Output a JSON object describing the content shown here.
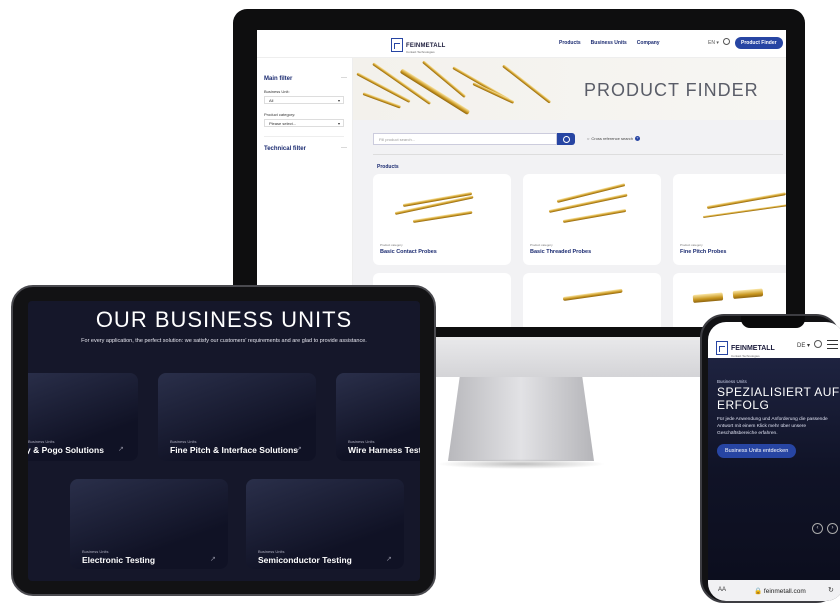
{
  "desktop": {
    "brand": "FEINMETALL",
    "brand_sub": "Contact Technologies",
    "nav": [
      "Products",
      "Business Units",
      "Company"
    ],
    "lang": "EN ▾",
    "product_finder_btn": "Product Finder",
    "sidebar": {
      "main_filter": "Main filter",
      "business_unit_label": "Business Unit:",
      "business_unit_value": "All",
      "product_category_label": "Product category:",
      "product_category_value": "Please select...",
      "technical_filter": "Technical filter",
      "collapse_symbol": "—",
      "expand_symbol": "—"
    },
    "hero_title": "PRODUCT FINDER",
    "search_placeholder": "Fill product search...",
    "cross_reference": "Cross reference search",
    "info_symbol": "?",
    "products_heading": "Products",
    "cards": [
      {
        "category": "Product category",
        "name": "Basic Contact Probes"
      },
      {
        "category": "Product category",
        "name": "Basic Threaded Probes"
      },
      {
        "category": "Product category",
        "name": "Fine Pitch Probes"
      }
    ]
  },
  "tablet": {
    "title": "OUR BUSINESS UNITS",
    "subtitle": "For every application, the perfect solution: we satisfy our customers' requirements and are glad to provide assistance.",
    "units": [
      {
        "label": "Business Units",
        "name": "y & Pogo Solutions"
      },
      {
        "label": "Business Units",
        "name": "Fine Pitch & Interface Solutions"
      },
      {
        "label": "Business Units",
        "name": "Wire Harness Test"
      },
      {
        "label": "Business Units",
        "name": "Electronic Testing"
      },
      {
        "label": "Business Units",
        "name": "Semiconductor Testing"
      }
    ],
    "arrow": "↗"
  },
  "phone": {
    "brand": "FEINMETALL",
    "brand_sub": "Contact Technologies",
    "lang": "DE ▾",
    "section_label": "Business Units",
    "headline": "SPEZIALISIERT AUF ERFOLG",
    "description": "Für jede Anwendung und Anforderung die passende Antwort mit einem Klick mehr über unsere Geschäftsbereiche erfahren.",
    "cta": "Business Units entdecken",
    "prev": "‹",
    "next": "›",
    "browser_aa": "AA",
    "url": "🔒 feinmetall.com",
    "reload": "↻"
  }
}
